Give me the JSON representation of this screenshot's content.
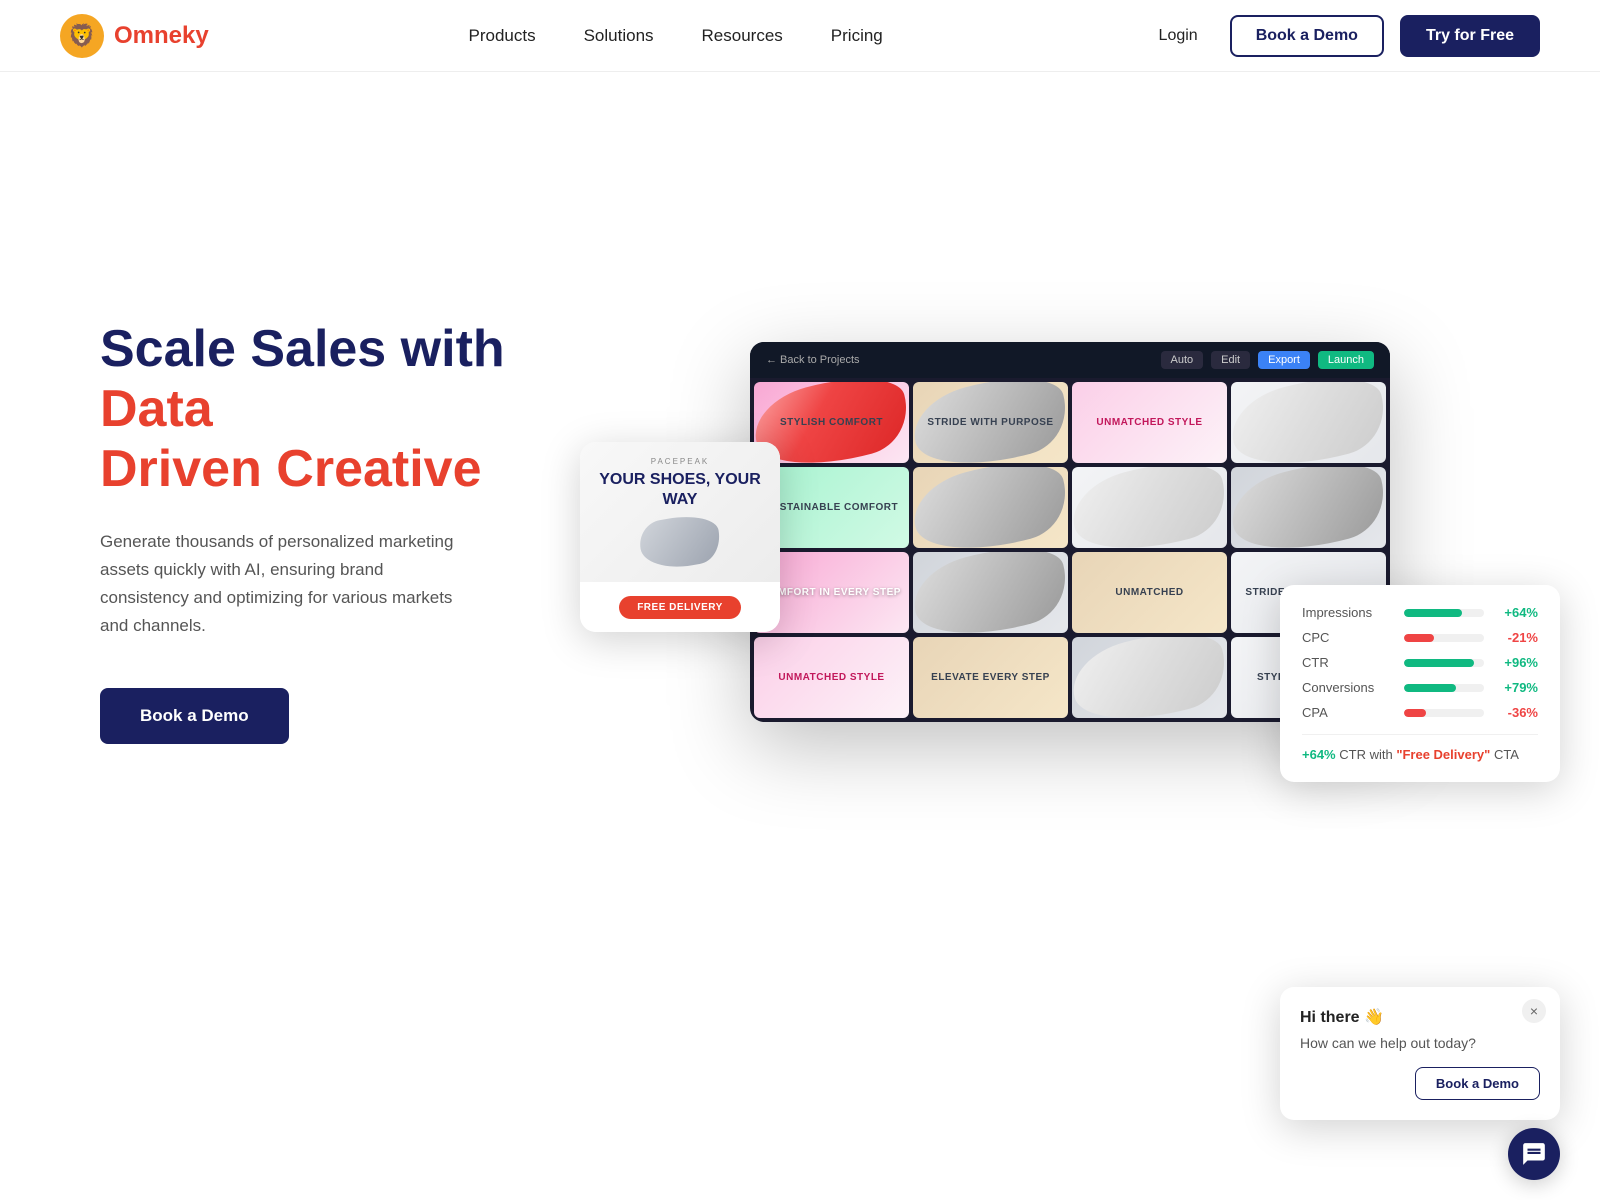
{
  "brand": {
    "name": "Omneky",
    "logo_emoji": "🦁",
    "logo_color": "#f5a623",
    "text_color": "#e8412e"
  },
  "nav": {
    "links": [
      {
        "id": "products",
        "label": "Products"
      },
      {
        "id": "solutions",
        "label": "Solutions"
      },
      {
        "id": "resources",
        "label": "Resources"
      },
      {
        "id": "pricing",
        "label": "Pricing"
      }
    ],
    "login_label": "Login",
    "book_demo_label": "Book a Demo",
    "try_free_label": "Try for Free"
  },
  "hero": {
    "title_part1": "Scale Sales with ",
    "title_highlight": "Data Driven Creative",
    "description": "Generate thousands of personalized marketing assets quickly with AI, ensuring brand consistency and optimizing for various markets and channels.",
    "cta_label": "Book a Demo"
  },
  "dashboard": {
    "toolbar": {
      "back_label": "← Back to Projects",
      "auto_label": "Auto",
      "edit_label": "Edit",
      "export_label": "Export",
      "launch_label": "Launch"
    },
    "cells": [
      {
        "text": "STYLISH COMFORT",
        "style": "pink"
      },
      {
        "text": "STRIDE WITH PURPOSE",
        "style": "beige"
      },
      {
        "text": "UNMATCHED STYLE",
        "style": "pink2"
      },
      {
        "text": "",
        "style": "light"
      },
      {
        "text": "SUSTAINABLE COMFORT",
        "style": "green"
      },
      {
        "text": "",
        "style": "beige"
      },
      {
        "text": "",
        "style": "light"
      },
      {
        "text": "",
        "style": "gray"
      },
      {
        "text": "COMFORT IN EVERY STEP",
        "style": "pink"
      },
      {
        "text": "",
        "style": "gray"
      },
      {
        "text": "UNMATCHED",
        "style": "beige"
      },
      {
        "text": "STRIDE WITH PURPOSE",
        "style": "light"
      },
      {
        "text": "UNMATCHED STYLE",
        "style": "pink2"
      },
      {
        "text": "ELEVATE EVERY STEP",
        "style": "beige"
      },
      {
        "text": "",
        "style": "gray"
      },
      {
        "text": "STYLISH COMFORT",
        "style": "light"
      }
    ]
  },
  "popup_ad": {
    "brand": "PACEPEAK",
    "headline": "YOUR SHOES, YOUR WAY",
    "cta": "FREE DELIVERY"
  },
  "metrics": {
    "rows": [
      {
        "label": "Impressions",
        "bar_pct": 72,
        "value": "+64%",
        "positive": true
      },
      {
        "label": "CPC",
        "bar_pct": 38,
        "value": "-21%",
        "positive": false
      },
      {
        "label": "CTR",
        "bar_pct": 88,
        "value": "+96%",
        "positive": true
      },
      {
        "label": "Conversions",
        "bar_pct": 65,
        "value": "+79%",
        "positive": true
      },
      {
        "label": "CPA",
        "bar_pct": 28,
        "value": "-36%",
        "positive": false
      }
    ],
    "footer_highlight": "+64%",
    "footer_text": " CTR with ",
    "footer_cta": "\"Free Delivery\"",
    "footer_suffix": " CTA"
  },
  "chat": {
    "greeting": "Hi there 👋",
    "subtext": "How can we help out today?",
    "book_demo_label": "Book a Demo",
    "close_label": "×"
  }
}
